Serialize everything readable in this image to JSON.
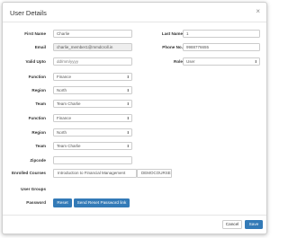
{
  "dialog": {
    "title": "User Details",
    "close_glyph": "×"
  },
  "fields": {
    "first_name": {
      "label": "First Name",
      "value": "Charlie"
    },
    "last_name": {
      "label": "Last Name",
      "value": "1"
    },
    "email": {
      "label": "Email",
      "value": "charlie_member1@mmdcroll.in"
    },
    "phone": {
      "label": "Phone No.",
      "value": "9988776655"
    },
    "valid_upto": {
      "label": "Valid Upto",
      "placeholder": "dd/mm/yyyy"
    },
    "role": {
      "label": "Role",
      "value": "User"
    },
    "function1": {
      "label": "Function",
      "value": "Finance"
    },
    "region1": {
      "label": "Region",
      "value": "North"
    },
    "team1": {
      "label": "Team",
      "value": "Team Charlie"
    },
    "function2": {
      "label": "Function",
      "value": "Finance"
    },
    "region2": {
      "label": "Region",
      "value": "North"
    },
    "team2": {
      "label": "Team",
      "value": "Team Charlie"
    },
    "zipcode": {
      "label": "Zipcode",
      "value": ""
    },
    "enrolled_courses": {
      "label": "Enrolled Courses",
      "items": [
        "Introduction to Financial Management",
        "DEMOCOURSE"
      ]
    },
    "user_groups": {
      "label": "User Groups"
    },
    "password": {
      "label": "Password",
      "reset_label": "Reset",
      "send_link_label": "Send Reset Password link"
    }
  },
  "footer": {
    "cancel_label": "Cancel",
    "save_label": "Save"
  },
  "colors": {
    "primary": "#337ab7",
    "readonly_bg": "#eeeeee",
    "border": "#cccccc"
  }
}
